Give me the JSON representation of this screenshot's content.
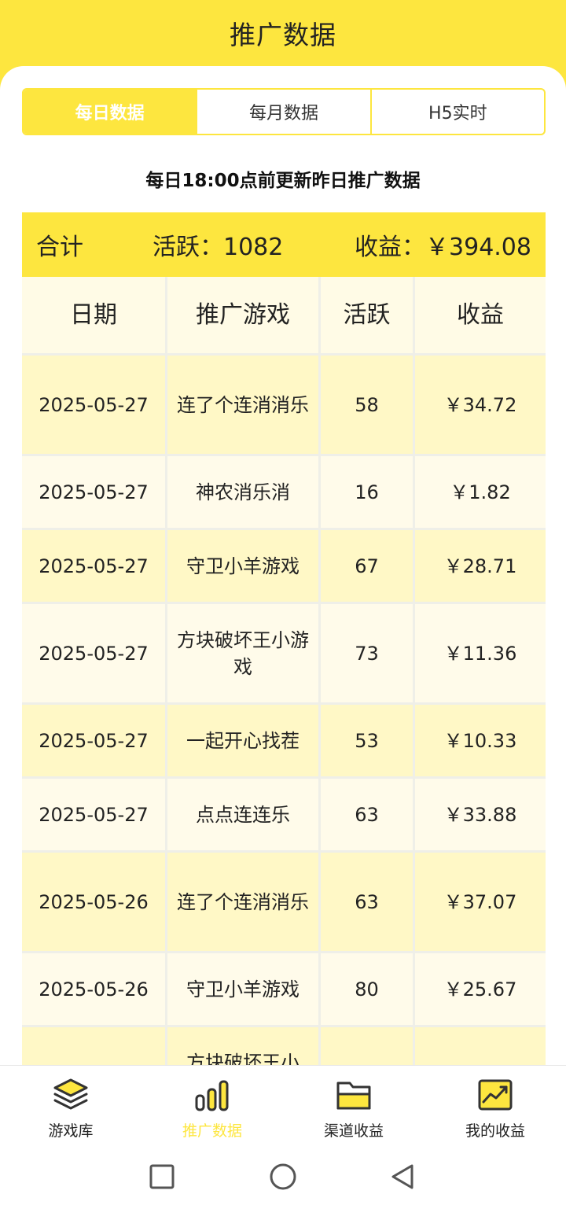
{
  "header": {
    "title": "推广数据"
  },
  "tabs": [
    {
      "label": "每日数据",
      "active": true
    },
    {
      "label": "每月数据",
      "active": false
    },
    {
      "label": "H5实时",
      "active": false
    }
  ],
  "notice": "每日18:00点前更新昨日推广数据",
  "summary": {
    "label": "合计",
    "active_text": "活跃：1082",
    "income_text": "收益：￥394.08"
  },
  "table": {
    "headers": [
      "日期",
      "推广游戏",
      "活跃",
      "收益"
    ],
    "rows": [
      {
        "date": "2025-05-27",
        "game": "连了个连消消乐",
        "active": "58",
        "income": "￥34.72"
      },
      {
        "date": "2025-05-27",
        "game": "神农消乐消",
        "active": "16",
        "income": "￥1.82"
      },
      {
        "date": "2025-05-27",
        "game": "守卫小羊游戏",
        "active": "67",
        "income": "￥28.71"
      },
      {
        "date": "2025-05-27",
        "game": "方块破坏王小游戏",
        "active": "73",
        "income": "￥11.36"
      },
      {
        "date": "2025-05-27",
        "game": "一起开心找茬",
        "active": "53",
        "income": "￥10.33"
      },
      {
        "date": "2025-05-27",
        "game": "点点连连乐",
        "active": "63",
        "income": "￥33.88"
      },
      {
        "date": "2025-05-26",
        "game": "连了个连消消乐",
        "active": "63",
        "income": "￥37.07"
      },
      {
        "date": "2025-05-26",
        "game": "守卫小羊游戏",
        "active": "80",
        "income": "￥25.67"
      },
      {
        "date": "",
        "game": "方块破坏王小",
        "active": "",
        "income": ""
      }
    ]
  },
  "nav": [
    {
      "label": "游戏库",
      "icon": "layers-icon",
      "active": false
    },
    {
      "label": "推广数据",
      "icon": "bar-chart-icon",
      "active": true
    },
    {
      "label": "渠道收益",
      "icon": "folder-icon",
      "active": false
    },
    {
      "label": "我的收益",
      "icon": "trend-chart-icon",
      "active": false
    }
  ],
  "colors": {
    "accent": "#fde63f",
    "row_odd": "#fff8c6",
    "row_even": "#fffbea"
  }
}
